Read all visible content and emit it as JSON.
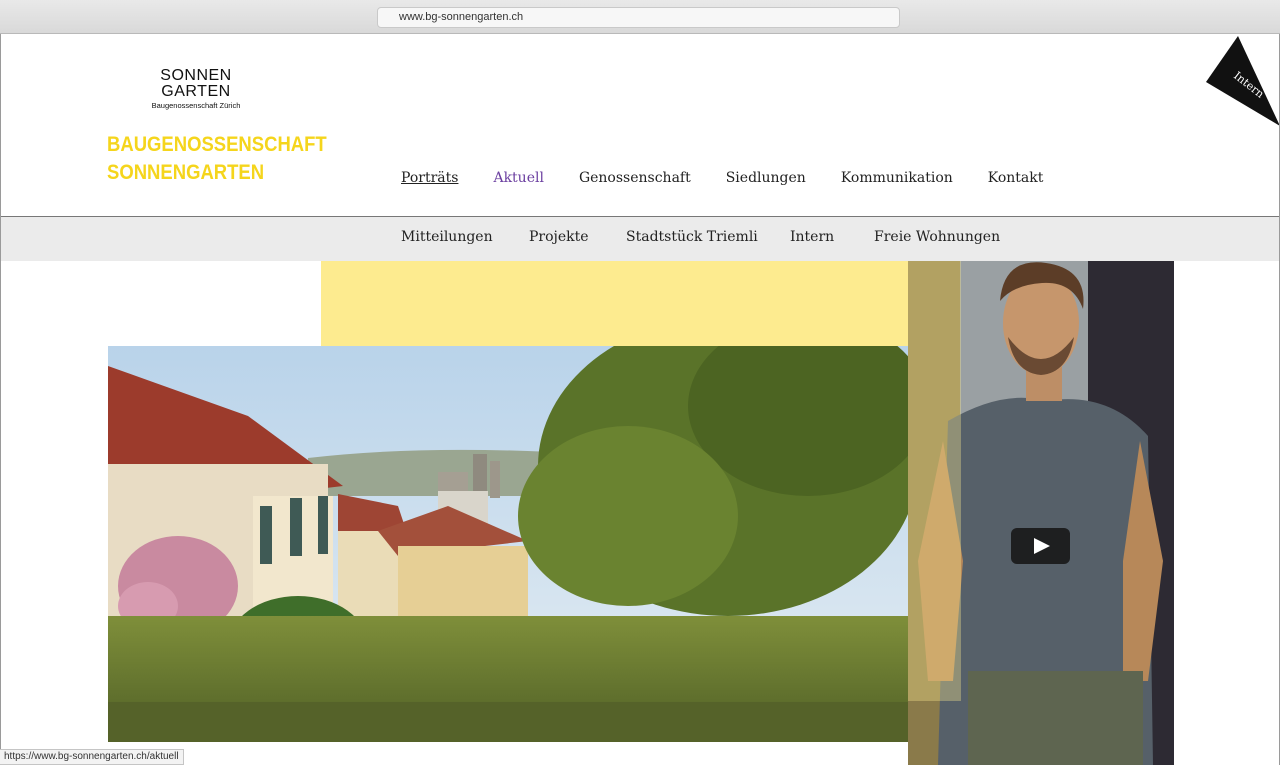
{
  "browser": {
    "url": "www.bg-sonnengarten.ch"
  },
  "status_bar": {
    "text": "https://www.bg-sonnengarten.ch/aktuell"
  },
  "logo": {
    "line1": "SONNEN",
    "line2": "GARTEN",
    "line3": "Baugenossenschaft Zürich"
  },
  "brand": {
    "line1": "BAUGENOSSENSCHAFT",
    "line2": "SONNENGARTEN",
    "color": "#f5d51c"
  },
  "intern_corner": {
    "label": "Intern"
  },
  "main_nav": {
    "items": [
      {
        "label": "Porträts"
      },
      {
        "label": "Aktuell"
      },
      {
        "label": "Genossenschaft"
      },
      {
        "label": "Siedlungen"
      },
      {
        "label": "Kommunikation"
      },
      {
        "label": "Kontakt"
      }
    ],
    "active_color": "#6b3fa0"
  },
  "sub_nav": {
    "items": [
      {
        "label": "Mitteilungen"
      },
      {
        "label": "Projekte"
      },
      {
        "label": "Stadtstück Triemli"
      },
      {
        "label": "Intern"
      },
      {
        "label": "Freie Wohnungen"
      }
    ]
  },
  "hero": {
    "video_icon": "play-icon"
  }
}
